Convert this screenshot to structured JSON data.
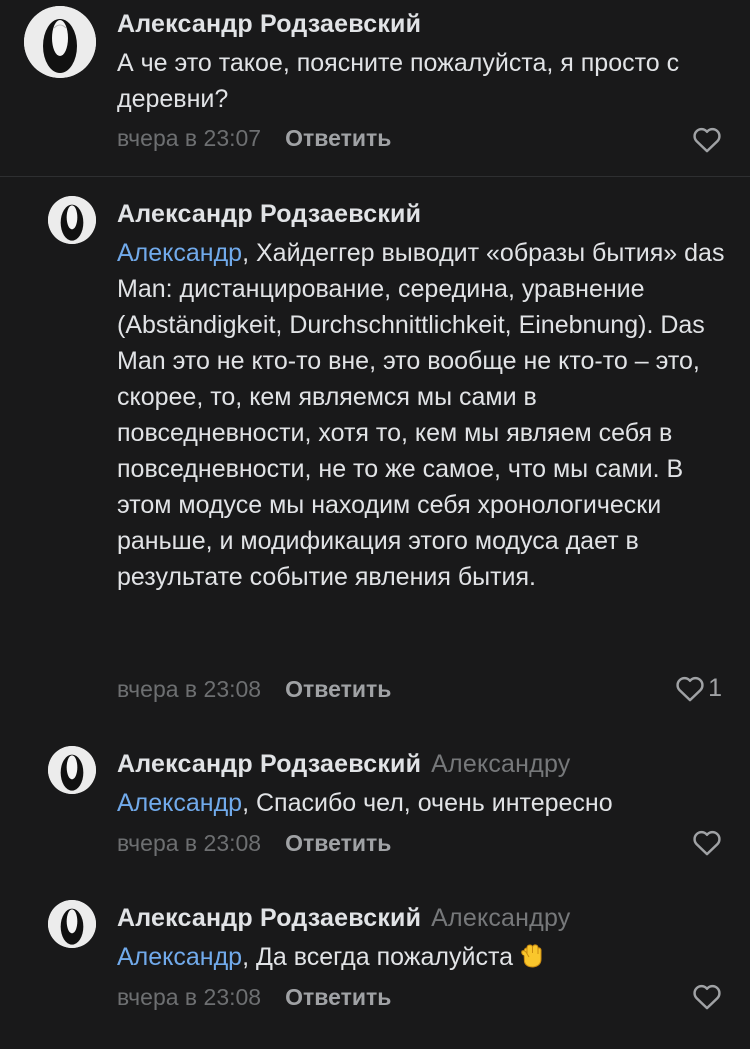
{
  "comments": [
    {
      "author": "Александр Родзаевский",
      "reply_to": "",
      "mention": "",
      "text": "А че это такое, поясните пожалуйста, я просто с деревни?",
      "time": "вчера в 23:07",
      "reply_label": "Ответить",
      "likes": ""
    },
    {
      "author": "Александр Родзаевский",
      "reply_to": "",
      "mention": "Александр",
      "text": ", Хайдеггер выводит «образы бытия» das Man: дистанцирование, середина, уравнение (Abständigkeit, Durchschnittlichkeit, Einebnung). Das Man это не кто-то вне, это вообще не кто-то – это, скорее, то, кем являемся мы сами в повседневности, хотя то, кем мы являем себя в повседневности, не то же самое, что мы сами. В этом модусе мы находим себя хронологически раньше, и модификация этого модуса дает в результате событие явления бытия.",
      "time": "вчера в 23:08",
      "reply_label": "Ответить",
      "likes": "1"
    },
    {
      "author": "Александр Родзаевский",
      "reply_to": "Александру",
      "mention": "Александр",
      "text": ", Спасибо чел, очень интересно",
      "time": "вчера в 23:08",
      "reply_label": "Ответить",
      "likes": ""
    },
    {
      "author": "Александр Родзаевский",
      "reply_to": "Александру",
      "mention": "Александр",
      "text": ", Да всегда пожалуйста",
      "time": "вчера в 23:08",
      "reply_label": "Ответить",
      "likes": ""
    }
  ],
  "icons": {
    "like": "heart-icon",
    "emoji": "raised-fist-emoji",
    "avatar": "anonymous-mask-avatar"
  },
  "colors": {
    "background": "#19191a",
    "text": "#e1e3e6",
    "mention": "#71aaeb",
    "secondary": "#76787a"
  }
}
